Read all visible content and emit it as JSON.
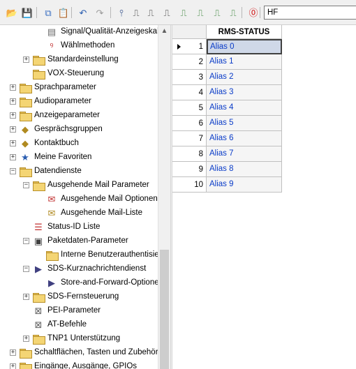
{
  "toolbar": {
    "search_value": "HF",
    "buttons": [
      {
        "name": "open-folder-icon",
        "glyph": "📂",
        "color": "#c89b2a"
      },
      {
        "name": "save-icon",
        "glyph": "💾",
        "color": "#3358a8"
      },
      {
        "name": "copy-icon",
        "glyph": "⧉",
        "color": "#3a6fc2"
      },
      {
        "name": "paste-icon",
        "glyph": "📋",
        "color": "#8a8a8a"
      },
      {
        "name": "undo-icon",
        "glyph": "↶",
        "color": "#2a5db0"
      },
      {
        "name": "redo-icon",
        "glyph": "↷",
        "color": "#9a9a9a"
      },
      {
        "name": "pin-icon",
        "glyph": "⫯",
        "color": "#204080"
      },
      {
        "name": "radio-read-icon",
        "glyph": "⎍",
        "color": "#303030"
      },
      {
        "name": "radio-write-icon",
        "glyph": "⎍",
        "color": "#303030"
      },
      {
        "name": "radio-program-icon",
        "glyph": "⎍",
        "color": "#303030"
      },
      {
        "name": "radio-clone-icon",
        "glyph": "⎍",
        "color": "#2a7a2a"
      },
      {
        "name": "radio-upgrade-icon",
        "glyph": "⎍",
        "color": "#2a7a2a"
      },
      {
        "name": "radio-signal-icon",
        "glyph": "⎍",
        "color": "#2a7a2a"
      },
      {
        "name": "radio-check-icon",
        "glyph": "⎍",
        "color": "#2a7a2a"
      },
      {
        "name": "stop-icon",
        "glyph": "⓪",
        "color": "#d01010"
      }
    ]
  },
  "tree": {
    "items": [
      {
        "label": "Signal/Qualität-Anzeigeskala",
        "icon": "signal-meter-icon",
        "expander": false
      },
      {
        "label": "Wählmethoden",
        "icon": "dial-method-icon",
        "expander": false
      },
      {
        "label": "Standardeinstellung",
        "icon": "folder-icon",
        "expander": true
      },
      {
        "label": "VOX-Steuerung",
        "icon": "folder-icon",
        "expander": false
      },
      {
        "label": "Sprachparameter",
        "icon": "folder-icon",
        "expander": true
      },
      {
        "label": "Audioparameter",
        "icon": "folder-icon",
        "expander": true
      },
      {
        "label": "Anzeigeparameter",
        "icon": "folder-icon",
        "expander": true
      },
      {
        "label": "Gesprächsgruppen",
        "icon": "talkgroup-icon",
        "expander": true
      },
      {
        "label": "Kontaktbuch",
        "icon": "contacts-icon",
        "expander": true
      },
      {
        "label": "Meine Favoriten",
        "icon": "favorites-icon",
        "expander": true
      },
      {
        "label": "Datendienste",
        "icon": "folder-icon",
        "expander": true,
        "expanded": true
      },
      {
        "label": "Ausgehende Mail Parameter",
        "icon": "folder-icon",
        "expander": true,
        "expanded": true
      },
      {
        "label": "Ausgehende Mail Optionen",
        "icon": "mail-options-icon",
        "expander": false
      },
      {
        "label": "Ausgehende Mail-Liste",
        "icon": "mail-list-icon",
        "expander": false
      },
      {
        "label": "Status-ID Liste",
        "icon": "status-list-icon",
        "expander": false
      },
      {
        "label": "Paketdaten-Parameter",
        "icon": "packet-data-icon",
        "expander": true,
        "expanded": true
      },
      {
        "label": "Interne Benutzerauthentisieru",
        "icon": "folder-icon",
        "expander": false
      },
      {
        "label": "SDS-Kurznachrichtendienst",
        "icon": "sds-icon",
        "expander": true,
        "expanded": true
      },
      {
        "label": "Store-and-Forward-Optionen",
        "icon": "sds-icon",
        "expander": false
      },
      {
        "label": "SDS-Fernsteuerung",
        "icon": "folder-icon",
        "expander": true
      },
      {
        "label": "PEI-Parameter",
        "icon": "pei-icon",
        "expander": false
      },
      {
        "label": "AT-Befehle",
        "icon": "pei-icon",
        "expander": false
      },
      {
        "label": "TNP1 Unterstützung",
        "icon": "folder-icon",
        "expander": true
      },
      {
        "label": "Schaltflächen, Tasten und Zubehör",
        "icon": "folder-icon",
        "expander": true
      },
      {
        "label": "Eingänge, Ausgänge, GPIOs",
        "icon": "folder-icon",
        "expander": true
      }
    ]
  },
  "grid": {
    "column_header": "RMS-STATUS",
    "rows": [
      {
        "num": "1",
        "alias": "Alias 0"
      },
      {
        "num": "2",
        "alias": "Alias 1"
      },
      {
        "num": "3",
        "alias": "Alias 2"
      },
      {
        "num": "4",
        "alias": "Alias 3"
      },
      {
        "num": "5",
        "alias": "Alias 4"
      },
      {
        "num": "6",
        "alias": "Alias 5"
      },
      {
        "num": "7",
        "alias": "Alias 6"
      },
      {
        "num": "8",
        "alias": "Alias 7"
      },
      {
        "num": "9",
        "alias": "Alias 8"
      },
      {
        "num": "10",
        "alias": "Alias 9"
      }
    ]
  },
  "colors": {
    "accent": "#0a3cc8",
    "selection": "#cfd8e8",
    "folder": "#f4d574"
  }
}
